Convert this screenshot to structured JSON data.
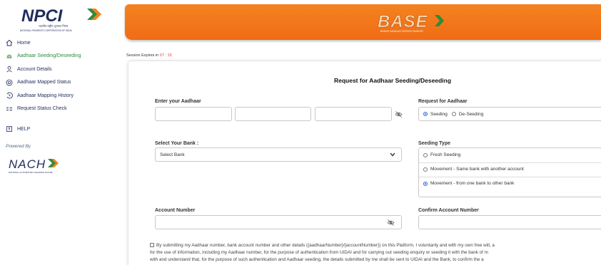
{
  "sidebar": {
    "logo_name": "NPCI",
    "logo_tagline_hi": "भारतीय राष्ट्रीय भुगतान निगम",
    "logo_tagline_en": "NATIONAL PAYMENTS CORPORATION OF INDIA",
    "items": [
      {
        "label": "Home",
        "icon": "home-icon"
      },
      {
        "label": "Aadhaar Seeding/Deseeding",
        "icon": "fingerprint-icon",
        "active": true
      },
      {
        "label": "Account Details",
        "icon": "account-icon"
      },
      {
        "label": "Aadhaar Mapped Status",
        "icon": "status-icon"
      },
      {
        "label": "Aadhaar Mapping History",
        "icon": "history-icon"
      },
      {
        "label": "Request Status Check",
        "icon": "list-icon"
      }
    ],
    "help_label": "HELP",
    "powered_by": "Powered By",
    "nach_name": "NACH",
    "nach_tagline": "NATIONAL AUTOMATED CLEARING HOUSE"
  },
  "header": {
    "logo_name": "BASE",
    "logo_tagline": "BHARAT AADHAAR SEEDING ENABLER"
  },
  "session": {
    "label": "Session Expires in",
    "time": "07 : 15"
  },
  "form": {
    "title": "Request for Aadhaar Seeding/Deseeding",
    "aadhaar_label": "Enter your Aadhaar",
    "request_label": "Request for Aadhaar",
    "request_options": [
      "Seeding",
      "De-Seeding"
    ],
    "request_selected": "Seeding",
    "bank_label": "Select Your Bank :",
    "bank_placeholder": "Select Bank",
    "seeding_type_label": "Seeding Type",
    "seeding_types": [
      "Fresh Seeding",
      "Movement - Same bank with another account",
      "Movement - from one bank to other bank"
    ],
    "seeding_type_selected": "Movement - from one bank to other bank",
    "account_label": "Account Number",
    "confirm_account_label": "Confirm Account Number",
    "consent_line1": "By submitting my Aadhaar number, bank account number and other details ({aadhaarNumber}/{accountNumber}) on this Platform, I voluntarily and with my own free will, a",
    "consent_line2": "for the use of information, including my Aadhaar number, for the purpose of authentication from UIDAI and for carrying out seeding enquiry or seeding it with the bank of m",
    "consent_line3": "with and understand that, for the purpose of such authentication and Aadhaar seeding, the details submitted by me shall be sent to UIDAI and the Bank, to confirm the a"
  },
  "colors": {
    "accent": "#f58220",
    "active_nav": "#2e8b3a",
    "nav_text": "#1f2d5c",
    "radio": "#2a63d6",
    "session_time": "#e53935"
  }
}
